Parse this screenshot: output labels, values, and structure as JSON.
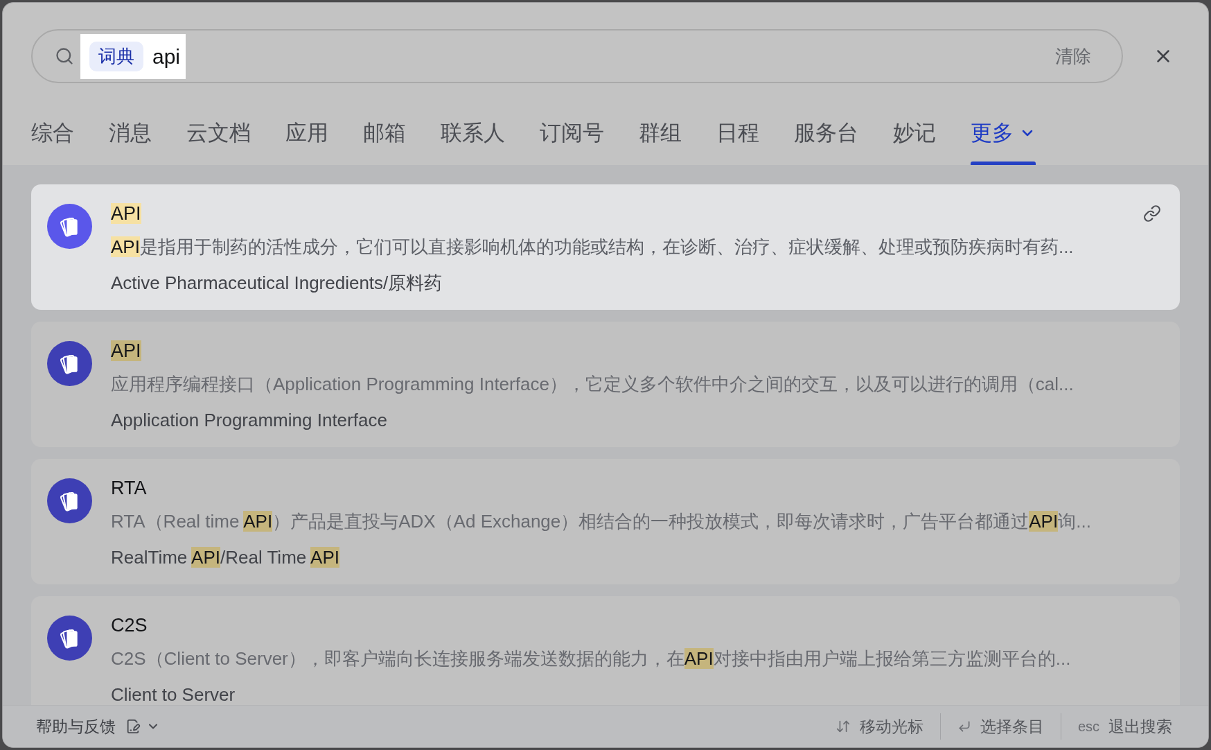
{
  "search": {
    "scope_tag": "词典",
    "query": "api",
    "spotlight": true,
    "clear_label": "清除"
  },
  "tabs": [
    {
      "label": "综合",
      "selected": false,
      "dropdown": false
    },
    {
      "label": "消息",
      "selected": false,
      "dropdown": false
    },
    {
      "label": "云文档",
      "selected": false,
      "dropdown": false
    },
    {
      "label": "应用",
      "selected": false,
      "dropdown": false
    },
    {
      "label": "邮箱",
      "selected": false,
      "dropdown": false
    },
    {
      "label": "联系人",
      "selected": false,
      "dropdown": false
    },
    {
      "label": "订阅号",
      "selected": false,
      "dropdown": false
    },
    {
      "label": "群组",
      "selected": false,
      "dropdown": false
    },
    {
      "label": "日程",
      "selected": false,
      "dropdown": false
    },
    {
      "label": "服务台",
      "selected": false,
      "dropdown": false
    },
    {
      "label": "妙记",
      "selected": false,
      "dropdown": false
    },
    {
      "label": "更多",
      "selected": true,
      "dropdown": true
    }
  ],
  "results": [
    {
      "selected": true,
      "title": [
        {
          "text": "API",
          "highlighted": true
        }
      ],
      "description": [
        {
          "text": "API",
          "highlighted": true
        },
        {
          "text": "是指用于制药的活性成分，它们可以直接影响机体的功能或结构，在诊断、治疗、症状缓解、处理或预防疾病时有药...",
          "highlighted": false
        }
      ],
      "subtitle": [
        {
          "text": "Active Pharmaceutical Ingredients/原料药",
          "highlighted": false
        }
      ]
    },
    {
      "selected": false,
      "title": [
        {
          "text": "API",
          "highlighted": true
        }
      ],
      "description": [
        {
          "text": "应用程序编程接口（Application Programming Interface），它定义多个软件中介之间的交互，以及可以进行的调用（cal...",
          "highlighted": false
        }
      ],
      "subtitle": [
        {
          "text": "Application Programming Interface",
          "highlighted": false
        }
      ]
    },
    {
      "selected": false,
      "title": [
        {
          "text": "RTA",
          "highlighted": false
        }
      ],
      "description": [
        {
          "text": "RTA（Real time ",
          "highlighted": false
        },
        {
          "text": "API",
          "highlighted": true
        },
        {
          "text": "）产品是直投与ADX（Ad Exchange）相结合的一种投放模式，即每次请求时，广告平台都通过",
          "highlighted": false
        },
        {
          "text": "API",
          "highlighted": true
        },
        {
          "text": "询...",
          "highlighted": false
        }
      ],
      "subtitle": [
        {
          "text": "RealTime ",
          "highlighted": false
        },
        {
          "text": "API",
          "highlighted": true
        },
        {
          "text": "/Real Time ",
          "highlighted": false
        },
        {
          "text": "API",
          "highlighted": true
        }
      ]
    },
    {
      "selected": false,
      "title": [
        {
          "text": "C2S",
          "highlighted": false
        }
      ],
      "description": [
        {
          "text": "C2S（Client to Server），即客户端向长连接服务端发送数据的能力，在",
          "highlighted": false
        },
        {
          "text": "API",
          "highlighted": true
        },
        {
          "text": "对接中指由用户端上报给第三方监测平台的...",
          "highlighted": false
        }
      ],
      "subtitle": [
        {
          "text": "Client to Server",
          "highlighted": false
        }
      ]
    }
  ],
  "footer": {
    "help_label": "帮助与反馈",
    "hints": [
      {
        "kind": "arrows",
        "label": "移动光标"
      },
      {
        "kind": "enter",
        "label": "选择条目"
      },
      {
        "kind": "key",
        "key": "esc",
        "label": "退出搜索"
      }
    ]
  }
}
